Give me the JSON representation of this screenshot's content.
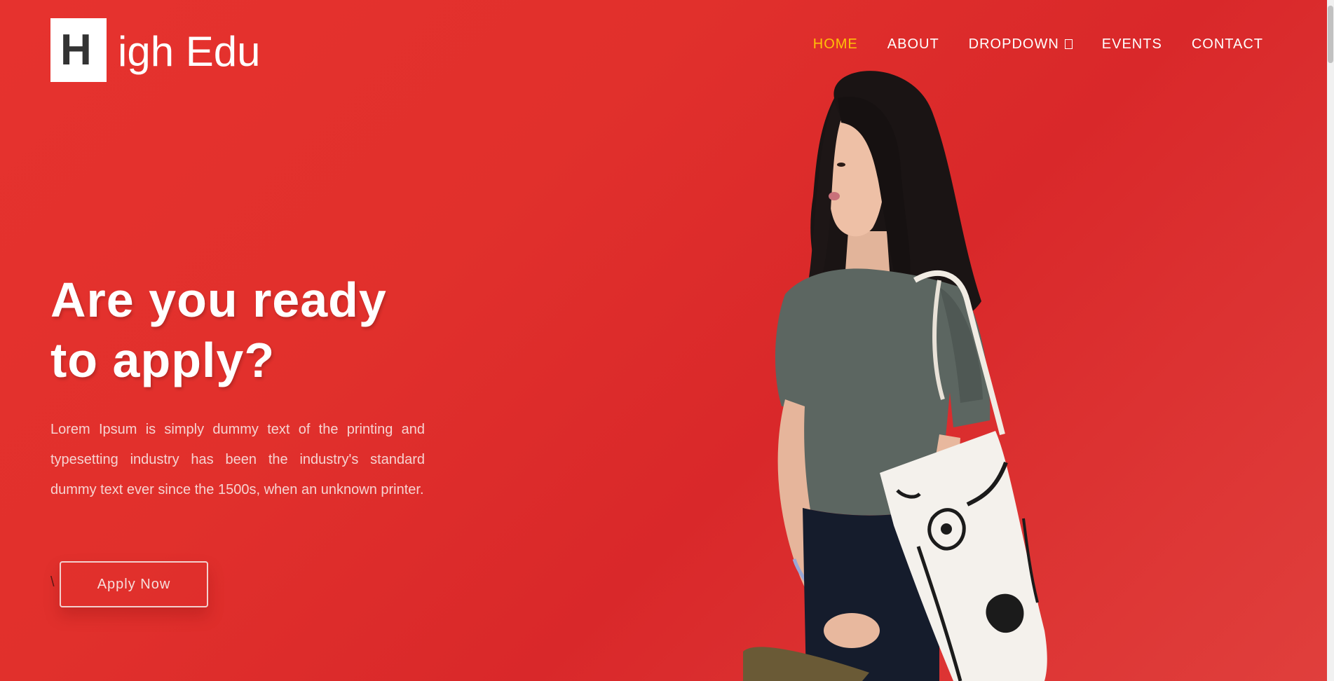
{
  "brand": {
    "initial": "H",
    "rest": "igh Edu"
  },
  "nav": {
    "items": [
      {
        "label": "HOME",
        "active": true
      },
      {
        "label": "ABOUT",
        "active": false
      },
      {
        "label": "DROPDOWN",
        "active": false,
        "has_caret": true
      },
      {
        "label": "EVENTS",
        "active": false
      },
      {
        "label": "CONTACT",
        "active": false
      }
    ]
  },
  "hero": {
    "headline_line1": "Are you ready",
    "headline_line2": "to apply?",
    "description": "Lorem Ipsum is simply dummy text of the printing and typesetting industry has been the industry's standard dummy text ever since the 1500s, when an unknown printer.",
    "stray_char": "\\",
    "cta_label": "Apply Now",
    "image_icon": "student-photo"
  },
  "colors": {
    "background": "#e3312d",
    "nav_active": "#ffc107",
    "nav_text": "#ffffff",
    "logo_box": "#ffffff",
    "logo_letter": "#333333"
  }
}
